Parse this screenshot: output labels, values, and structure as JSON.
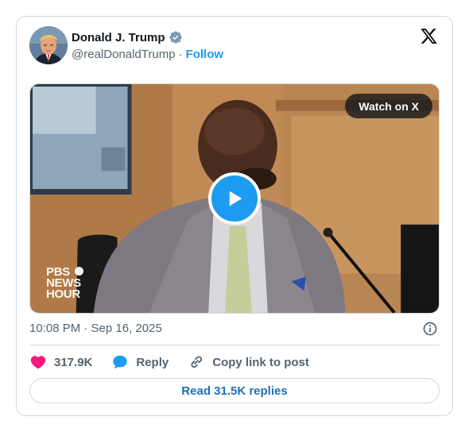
{
  "author": {
    "name": "Donald J. Trump",
    "handle": "@realDonaldTrump",
    "separator": "·",
    "follow_label": "Follow",
    "verified_badge_color": "#829aab"
  },
  "header": {
    "logo_icon": "x-logo-icon"
  },
  "media": {
    "watch_label": "Watch on X",
    "play_icon": "play-icon",
    "pbs_logo_lines": [
      "PBS",
      "NEWS",
      "HOUR"
    ]
  },
  "tweet": {
    "timestamp": "10:08 PM · Sep 16, 2025",
    "info_icon": "info-icon"
  },
  "actions": {
    "like_count": "317.9K",
    "reply_label": "Reply",
    "copy_label": "Copy link to post"
  },
  "footer": {
    "read_replies_label": "Read 31.5K replies"
  },
  "colors": {
    "accent": "#1d9bf0",
    "like": "#f91880",
    "muted_text": "#536471",
    "border": "#cfd9de"
  }
}
